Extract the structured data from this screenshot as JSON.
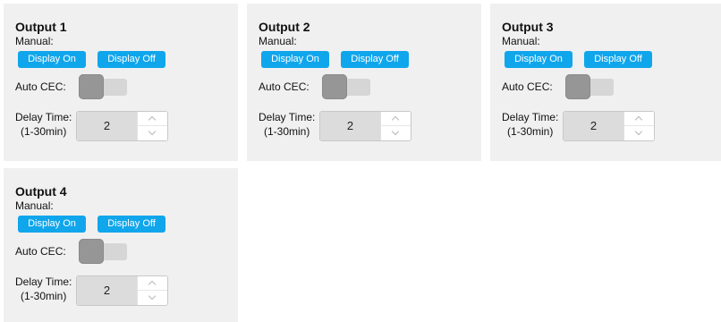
{
  "outputs": [
    {
      "title": "Output 1",
      "manual_label": "Manual:",
      "display_on_label": "Display On",
      "display_off_label": "Display Off",
      "auto_cec_label": "Auto CEC:",
      "auto_cec_enabled": false,
      "delay_label_line1": "Delay Time:",
      "delay_label_line2": "(1-30min)",
      "delay_value": "2"
    },
    {
      "title": "Output 2",
      "manual_label": "Manual:",
      "display_on_label": "Display On",
      "display_off_label": "Display Off",
      "auto_cec_label": "Auto CEC:",
      "auto_cec_enabled": false,
      "delay_label_line1": "Delay Time:",
      "delay_label_line2": "(1-30min)",
      "delay_value": "2"
    },
    {
      "title": "Output 3",
      "manual_label": "Manual:",
      "display_on_label": "Display On",
      "display_off_label": "Display Off",
      "auto_cec_label": "Auto CEC:",
      "auto_cec_enabled": false,
      "delay_label_line1": "Delay Time:",
      "delay_label_line2": "(1-30min)",
      "delay_value": "2"
    },
    {
      "title": "Output 4",
      "manual_label": "Manual:",
      "display_on_label": "Display On",
      "display_off_label": "Display Off",
      "auto_cec_label": "Auto CEC:",
      "auto_cec_enabled": false,
      "delay_label_line1": "Delay Time:",
      "delay_label_line2": "(1-30min)",
      "delay_value": "2"
    }
  ],
  "icons": {
    "increment": "chevron-up-icon",
    "decrement": "chevron-down-icon"
  },
  "colors": {
    "card_background": "#f0f0f0",
    "button_blue": "#10a6ec",
    "toggle_track": "#d6d6d6",
    "toggle_knob": "#969696",
    "stepper_field": "#dcdcdc"
  }
}
